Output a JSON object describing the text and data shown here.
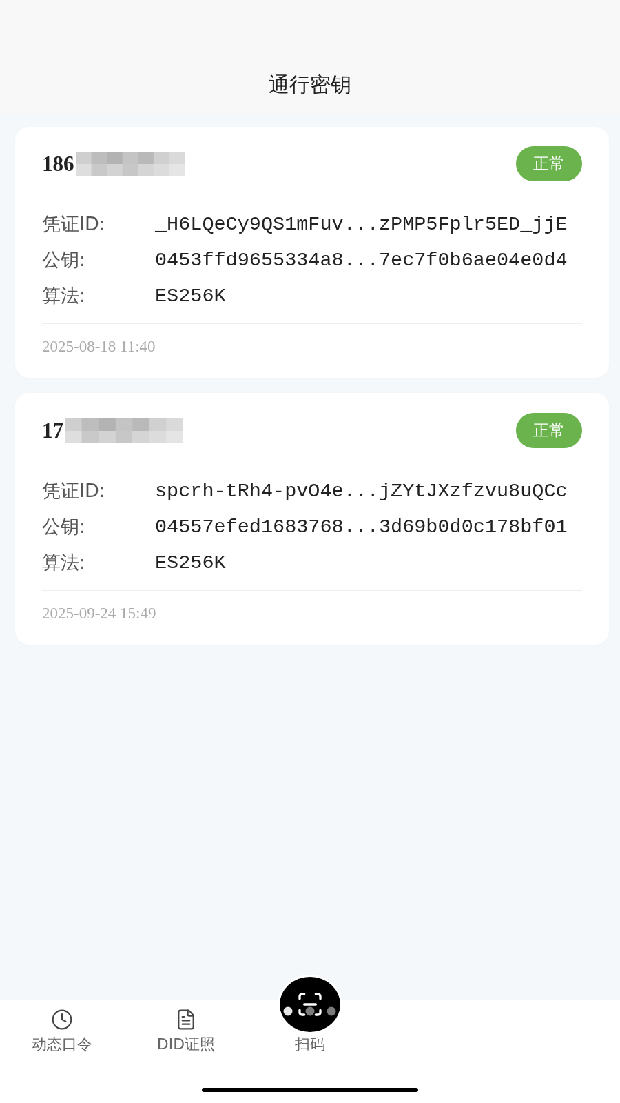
{
  "header": {
    "title": "通行密钥"
  },
  "passkeys": [
    {
      "account": "186",
      "status": "正常",
      "fields": [
        {
          "label": "凭证ID:",
          "value": "_H6LQeCy9QS1mFuv...zPMP5Fplr5ED_jjE"
        },
        {
          "label": "公钥:",
          "value": "0453ffd9655334a8...7ec7f0b6ae04e0d4"
        },
        {
          "label": "算法:",
          "value": "ES256K"
        }
      ],
      "created": "2025-08-18 11:40"
    },
    {
      "account": "17",
      "status": "正常",
      "fields": [
        {
          "label": "凭证ID:",
          "value": "spcrh-tRh4-pvO4e...jZYtJXzfzvu8uQCc"
        },
        {
          "label": "公钥:",
          "value": "04557efed1683768...3d69b0d0c178bf01"
        },
        {
          "label": "算法:",
          "value": "ES256K"
        }
      ],
      "created": "2025-09-24 15:49"
    }
  ],
  "tab_bar": {
    "tabs": [
      {
        "label": "动态口令",
        "kind": "plain",
        "selected": false
      },
      {
        "label": "DID证照",
        "kind": "plain",
        "selected": false
      },
      {
        "label": "扫码",
        "kind": "raised",
        "selected": false
      }
    ]
  }
}
